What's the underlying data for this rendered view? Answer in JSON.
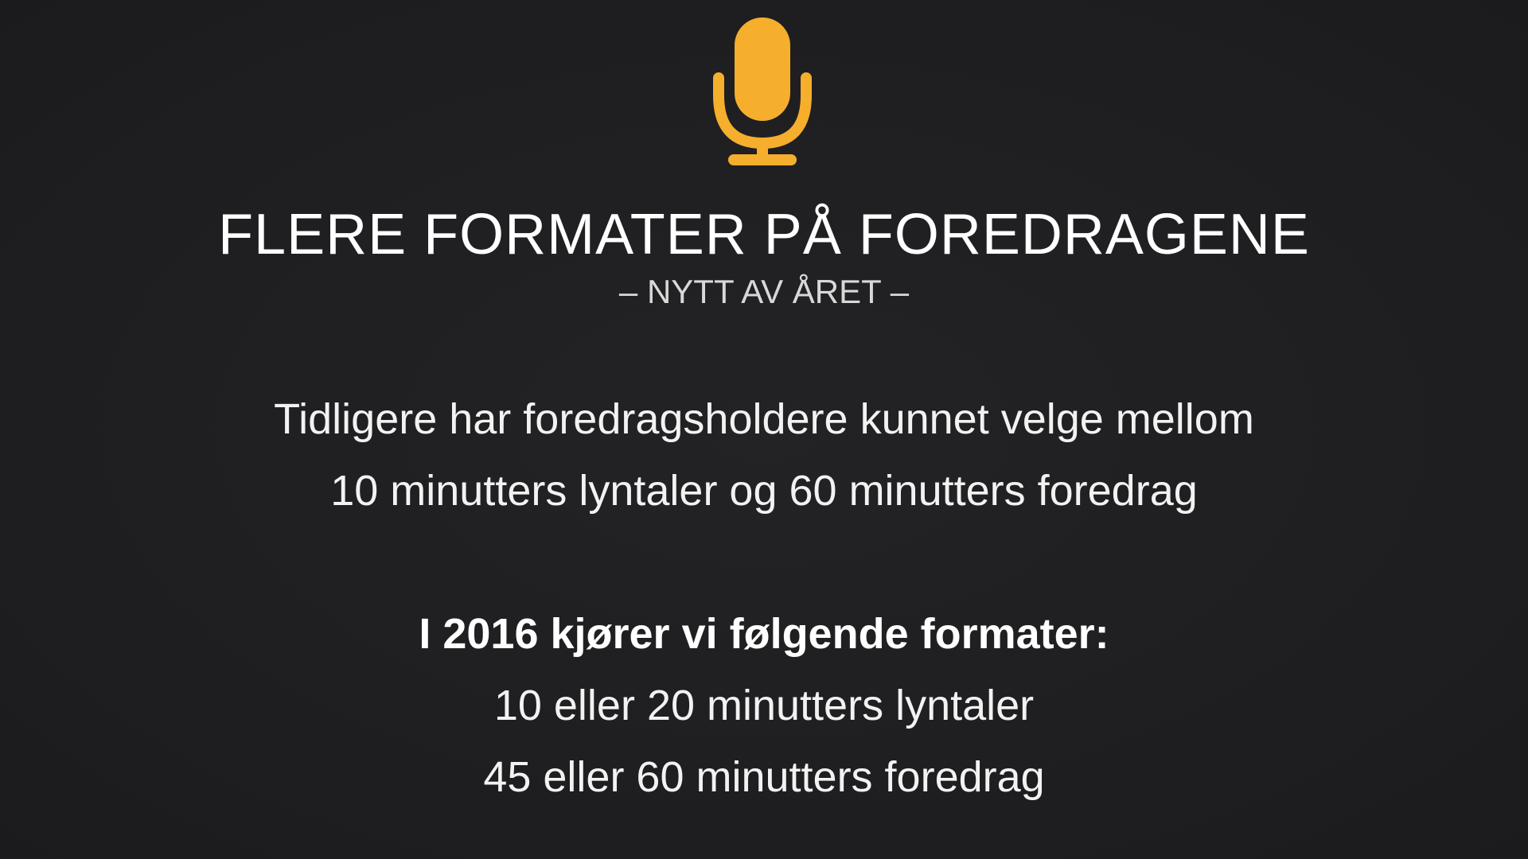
{
  "colors": {
    "background": "#1f1f21",
    "accent": "#f6ae2d",
    "text": "#ffffff"
  },
  "icon": "microphone-icon",
  "title": "FLERE FORMATER PÅ FOREDRAGENE",
  "subtitle": "– NYTT AV ÅRET –",
  "intro": {
    "line1": "Tidligere har foredragsholdere kunnet velge mellom",
    "line2": "10 minutters lyntaler og 60 minutters foredrag"
  },
  "formats": {
    "heading": "I 2016 kjører vi følgende formater:",
    "items": [
      "10 eller 20 minutters lyntaler",
      "45 eller 60 minutters foredrag"
    ]
  }
}
